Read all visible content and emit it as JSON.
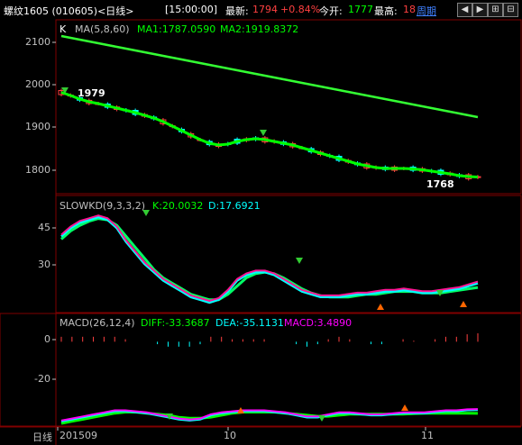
{
  "header": {
    "instrument": "螺纹1605 (010605)<日线>",
    "time": "[15:00:00]",
    "latest_label": "最新:",
    "latest_value": "1794",
    "change_pct": "+0.84%",
    "open_label": "今开:",
    "open_value": "1777",
    "high_label": "最高:",
    "high_value": "18",
    "period_link": "周期",
    "nav_icons": [
      "arrow-left-icon",
      "arrow-right-icon",
      "zoom-in-icon",
      "zoom-out-icon"
    ]
  },
  "main_panel": {
    "k_label": "K",
    "ma_label": "MA(5,8,60)",
    "ma1": "MA1:1787.0590",
    "ma2": "MA2:1919.8372",
    "y_ticks": [
      "2100",
      "2000",
      "1900",
      "1800"
    ],
    "annotations": {
      "high": "1979",
      "low": "1768"
    }
  },
  "kd_panel": {
    "label": "SLOWKD(9,3,3,2)",
    "k": "K:20.0032",
    "d": "D:17.6921",
    "y_ticks": [
      "45",
      "30"
    ]
  },
  "macd_panel": {
    "label": "MACD(26,12,4)",
    "diff": "DIFF:-33.3687",
    "dea": "DEA:-35.1131",
    "macd": "MACD:3.4890",
    "y_ticks": [
      "0",
      "-20"
    ]
  },
  "footer": {
    "period": "日线",
    "dates": [
      "201509",
      "10",
      "11"
    ]
  },
  "colors": {
    "background": "#000000",
    "up": "#ff4040",
    "down": "#00ffff",
    "ma1": "#ffffff",
    "ma_green": "#00ff00",
    "ma_long": "#33ff33",
    "macd_diff": "#ff00ff",
    "macd_dea": "#00ffff",
    "grid": "#800000"
  },
  "chart_data": [
    {
      "type": "candlestick",
      "title": "螺纹1605 (010605)<日线>",
      "ylim": [
        1760,
        2120
      ],
      "series": [
        {
          "name": "MA1",
          "values": [
            1975,
            1968,
            1960,
            1954,
            1950,
            1945,
            1940,
            1935,
            1930,
            1924,
            1918,
            1910,
            1900,
            1890,
            1880,
            1870,
            1862,
            1858,
            1860,
            1866,
            1870,
            1872,
            1870,
            1866,
            1862,
            1858,
            1852,
            1846,
            1840,
            1834,
            1828,
            1822,
            1816,
            1812,
            1808,
            1806,
            1806,
            1806,
            1805,
            1803,
            1800,
            1797,
            1794,
            1790,
            1788,
            1787
          ]
        },
        {
          "name": "MA2",
          "values": [
            2100,
            2096,
            2092,
            2088,
            2084,
            2080,
            2076,
            2072,
            2068,
            2064,
            2060,
            2056,
            2052,
            2048,
            2044,
            2040,
            2036,
            2032,
            2028,
            2024,
            2020,
            2016,
            2012,
            2008,
            2004,
            2000,
            1996,
            1992,
            1988,
            1984,
            1980,
            1976,
            1972,
            1968,
            1964,
            1960,
            1956,
            1952,
            1948,
            1944,
            1940,
            1936,
            1932,
            1928,
            1924,
            1920
          ]
        }
      ],
      "annotations": {
        "high": 1979,
        "low": 1768
      }
    },
    {
      "type": "line",
      "title": "SLOWKD(9,3,3,2)",
      "ylim": [
        14,
        48
      ],
      "series": [
        {
          "name": "K",
          "values": [
            40,
            43,
            45,
            46,
            47,
            46,
            43,
            38,
            34,
            30,
            27,
            24,
            22,
            20,
            18,
            17,
            16,
            17,
            20,
            24,
            26,
            27,
            27,
            26,
            24,
            22,
            20,
            19,
            18,
            18,
            18,
            18.5,
            19,
            19,
            19.5,
            20,
            20,
            20.5,
            20,
            19.5,
            19.5,
            20,
            20.5,
            21,
            22,
            23
          ]
        },
        {
          "name": "D",
          "values": [
            39,
            42,
            44,
            45.5,
            46.5,
            46,
            44,
            40,
            36,
            32,
            28,
            25,
            23,
            21,
            19,
            18,
            17,
            17,
            19,
            22,
            25,
            26.5,
            27,
            26.5,
            25,
            23,
            21,
            19.5,
            18.5,
            18,
            18,
            18,
            18.5,
            19,
            19,
            19.5,
            20,
            20,
            20,
            19.5,
            19.5,
            19.5,
            20,
            20.5,
            21,
            21.5
          ]
        }
      ]
    },
    {
      "type": "line",
      "title": "MACD(26,12,4)",
      "ylim": [
        -40,
        5
      ],
      "series": [
        {
          "name": "DIFF",
          "values": [
            -39,
            -38,
            -37,
            -36,
            -35,
            -34,
            -34,
            -34.5,
            -35,
            -36,
            -37,
            -38,
            -38.5,
            -38,
            -36,
            -35,
            -34.5,
            -34,
            -34,
            -34,
            -34.5,
            -35,
            -36,
            -37,
            -37,
            -36,
            -35,
            -35,
            -35.5,
            -36,
            -36,
            -35.5,
            -35,
            -35,
            -35,
            -34.5,
            -34,
            -34,
            -33.5,
            -33.4
          ]
        },
        {
          "name": "DEA",
          "values": [
            -40,
            -39,
            -38,
            -37,
            -36,
            -35,
            -34.5,
            -34.5,
            -35,
            -35.5,
            -36,
            -37,
            -37.5,
            -37.5,
            -37,
            -36,
            -35,
            -34.5,
            -34.5,
            -34.5,
            -34.5,
            -35,
            -35.5,
            -36,
            -36.5,
            -36.5,
            -36,
            -35.5,
            -35.5,
            -35.5,
            -35.5,
            -35.5,
            -35.5,
            -35.2,
            -35,
            -35,
            -35,
            -35,
            -35,
            -35.1
          ]
        }
      ]
    }
  ]
}
